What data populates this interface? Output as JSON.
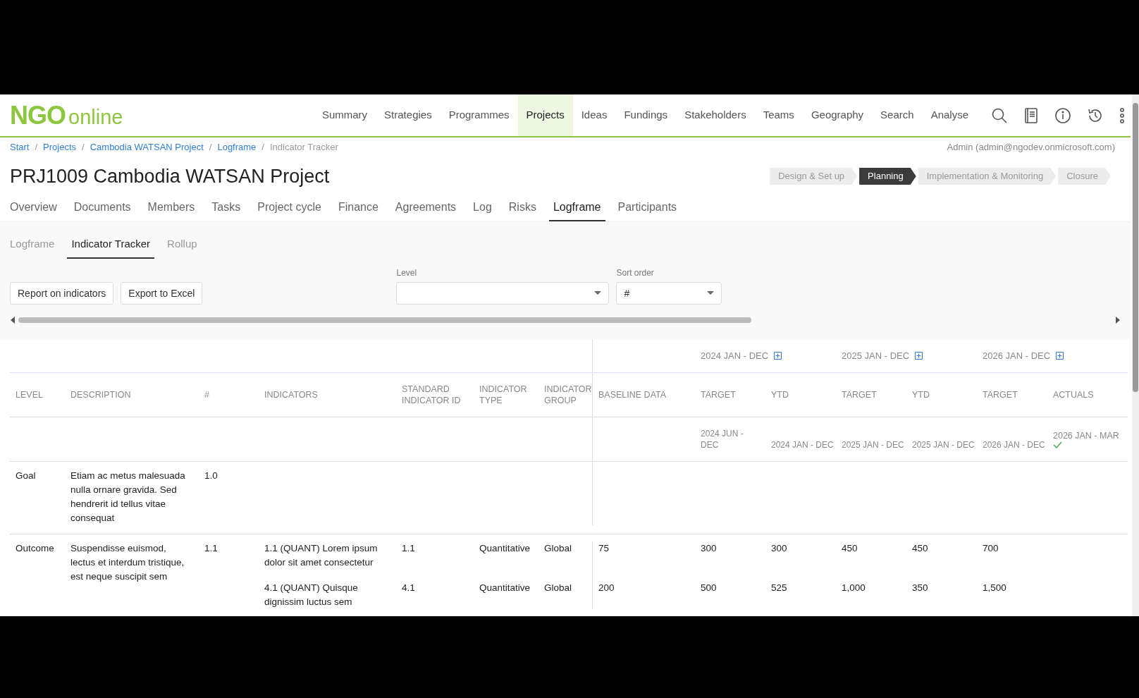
{
  "logo": {
    "primary": "NGO",
    "secondary": "online"
  },
  "nav": [
    {
      "label": "Summary",
      "selected": false
    },
    {
      "label": "Strategies",
      "selected": false
    },
    {
      "label": "Programmes",
      "selected": false
    },
    {
      "label": "Projects",
      "selected": true
    },
    {
      "label": "Ideas",
      "selected": false
    },
    {
      "label": "Fundings",
      "selected": false
    },
    {
      "label": "Stakeholders",
      "selected": false
    },
    {
      "label": "Teams",
      "selected": false
    },
    {
      "label": "Geography",
      "selected": false
    },
    {
      "label": "Search",
      "selected": false
    },
    {
      "label": "Analyse",
      "selected": false
    }
  ],
  "breadcrumb": [
    {
      "label": "Start",
      "current": false
    },
    {
      "separator": "/",
      "label": "Projects",
      "current": false
    },
    {
      "separator": "/",
      "label": "Cambodia WATSAN Project",
      "current": false
    },
    {
      "separator": "/",
      "label": "Logframe",
      "current": false
    },
    {
      "separator": "/",
      "label": "Indicator Tracker",
      "current": true
    }
  ],
  "user": "Admin (admin@ngodev.onmicrosoft.com)",
  "title": "PRJ1009 Cambodia WATSAN Project",
  "stages": [
    {
      "label": "Design & Set up",
      "selected": false
    },
    {
      "label": "Planning",
      "selected": true
    },
    {
      "label": "Implementation & Monitoring",
      "selected": false
    },
    {
      "label": "Closure",
      "selected": false
    }
  ],
  "tabs": [
    {
      "label": "Overview",
      "selected": false
    },
    {
      "label": "Documents",
      "selected": false
    },
    {
      "label": "Members",
      "selected": false
    },
    {
      "label": "Tasks",
      "selected": false
    },
    {
      "label": "Project cycle",
      "selected": false
    },
    {
      "label": "Finance",
      "selected": false
    },
    {
      "label": "Agreements",
      "selected": false
    },
    {
      "label": "Log",
      "selected": false
    },
    {
      "label": "Risks",
      "selected": false
    },
    {
      "label": "Logframe",
      "selected": true
    },
    {
      "label": "Participants",
      "selected": false
    }
  ],
  "subtabs": [
    {
      "label": "Logframe",
      "selected": false
    },
    {
      "label": "Indicator Tracker",
      "selected": true
    },
    {
      "label": "Rollup",
      "selected": false
    }
  ],
  "buttons": [
    "Report on indicators",
    "Export to Excel"
  ],
  "filters": [
    {
      "label": "Level"
    },
    {
      "label": "Sort order",
      "value": "#"
    }
  ],
  "table": {
    "period_groups": [
      "2024 JAN - DEC",
      "2025 JAN - DEC",
      "2026 JAN - DEC"
    ],
    "columns": [
      "LEVEL",
      "DESCRIPTION",
      "#",
      "INDICATORS",
      "STANDARD INDICATOR ID",
      "INDICATOR TYPE",
      "INDICATOR GROUP",
      "BASELINE DATA",
      "TARGET",
      "YTD",
      "TARGET",
      "YTD",
      "TARGET",
      "ACTUALS"
    ],
    "periods": [
      {
        "text": "2024 JUN - DEC",
        "checked": false
      },
      {
        "text": "2024 JAN - DEC",
        "checked": false
      },
      {
        "text": "2025 JAN - DEC",
        "checked": false
      },
      {
        "text": "2025 JAN - DEC",
        "checked": false
      },
      {
        "text": "2026 JAN - DEC",
        "checked": false
      },
      {
        "text": "2026 JAN - MAR",
        "checked": true
      }
    ],
    "rows": [
      {
        "level": "Goal",
        "description": "Etiam ac metus malesuada nulla ornare gravida. Sed hendrerit id tellus vitae consequat",
        "number": "1.0",
        "indicators": []
      },
      {
        "level": "Outcome",
        "description": "Suspendisse euismod, lectus et interdum tristique, est neque suscipit sem",
        "number": "1.1",
        "indicators": [
          {
            "text": "1.1 (QUANT) Lorem ipsum dolor sit amet consectetur",
            "standard_id": "1.1",
            "type": "Quantitative",
            "group": "Global",
            "baseline": "75",
            "values": [
              "300",
              "300",
              "450",
              "450",
              "700"
            ]
          },
          {
            "text": "4.1 (QUANT) Quisque dignissim luctus sem",
            "standard_id": "4.1",
            "type": "Quantitative",
            "group": "Global",
            "baseline": "200",
            "values": [
              "500",
              "525",
              "1,000",
              "350",
              "1,500"
            ]
          }
        ]
      }
    ]
  }
}
